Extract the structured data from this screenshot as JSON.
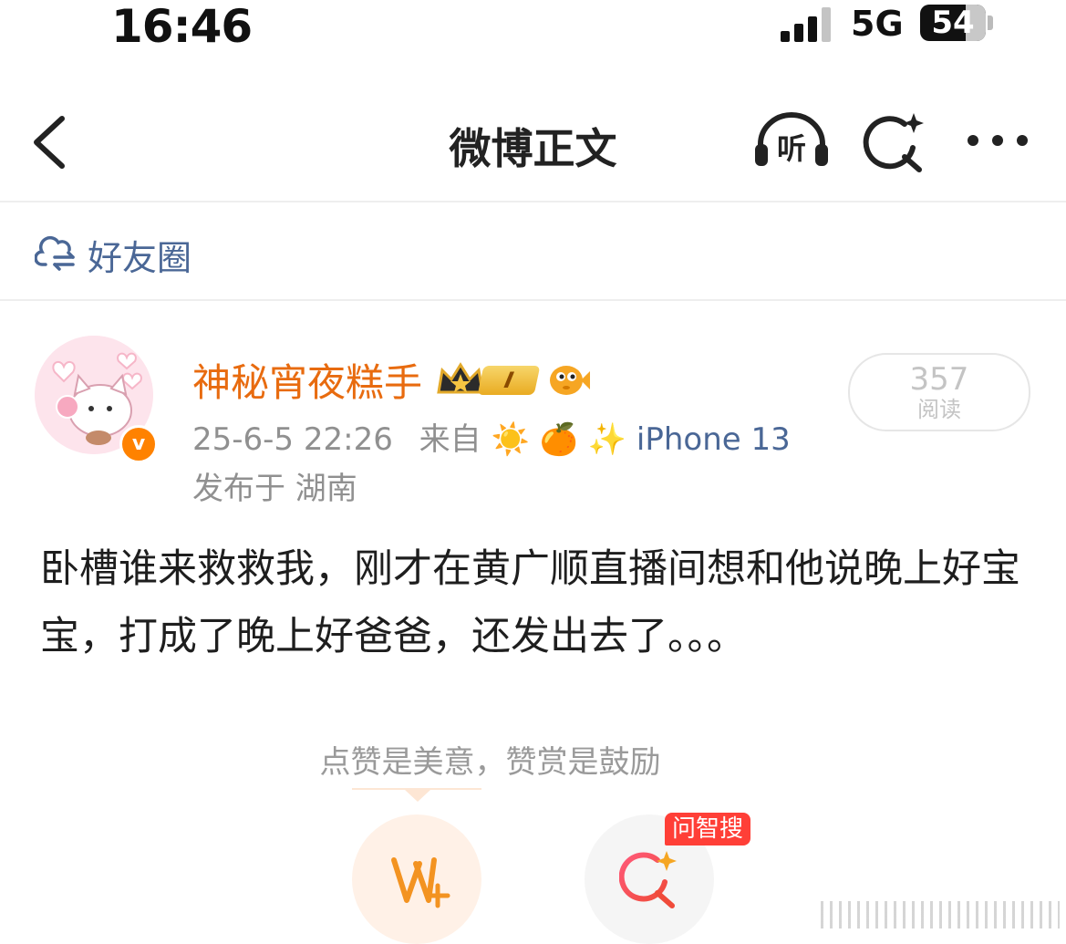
{
  "status_bar": {
    "time": "16:46",
    "network": "5G",
    "battery": "54",
    "battery_level_percent": 54,
    "signal_icon": "cellular-signal-icon"
  },
  "nav": {
    "title": "微博正文",
    "back_icon": "back-chevron-icon",
    "listen_icon": "headphones-listen-icon",
    "listen_glyph": "听",
    "search_icon": "ai-search-icon",
    "more_icon": "more-dots-icon"
  },
  "circle": {
    "label": "好友圈",
    "icon": "cloud-sync-icon"
  },
  "user": {
    "name": "神秘宵夜糕手",
    "badge_icons": [
      "crown-icon",
      "level-badge-icon",
      "pufferfish-icon"
    ],
    "level_text": "I",
    "verified_icon": "verified-v-icon",
    "verified_glyph": "v",
    "avatar_icon": "cat-avatar-icon"
  },
  "meta": {
    "date": "25-6-5 22:26",
    "source_prefix": "来自",
    "source_emojis": "☀️ 🍊 ✨",
    "device": "iPhone 13",
    "location": "发布于 湖南"
  },
  "reads": {
    "count": "357",
    "label": "阅读"
  },
  "post": {
    "text": "卧槽谁来救救我，刚才在黄广顺直播间想和他说晚上好宝宝，打成了晚上好爸爸，还发出去了。。。"
  },
  "actions": {
    "hint": "点赞是美意，赞赏是鼓励",
    "reward_icon": "reward-v-plus-icon",
    "search_icon": "ai-search-icon",
    "search_badge": "问智搜"
  },
  "colors": {
    "username": "#e86b0f",
    "link_blue": "#4a6796",
    "badge_red": "#ff3f37",
    "verify_orange": "#ff8200"
  }
}
